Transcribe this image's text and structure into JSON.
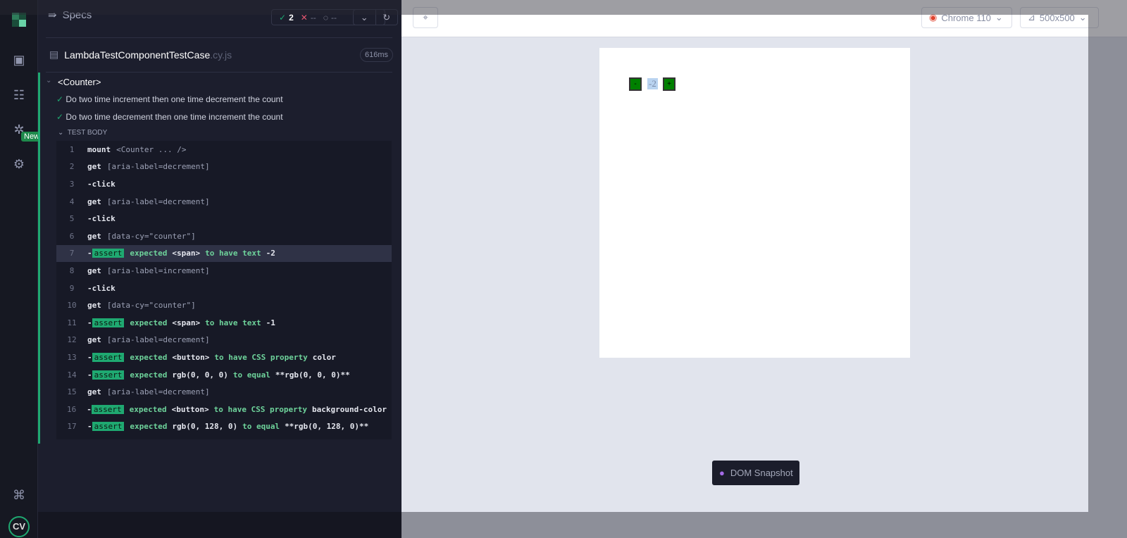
{
  "nav": {
    "new_badge": "New",
    "avatar": "CV"
  },
  "specs": {
    "title": "Specs",
    "passed": "2",
    "failed": "--",
    "pending": "--"
  },
  "file": {
    "name": "LambdaTestComponentTestCase",
    "ext": ".cy.js",
    "duration": "616ms"
  },
  "suite": {
    "name": "<Counter>",
    "tests": [
      "Do two time increment then one time decrement the count",
      "Do two time decrement then one time increment the count"
    ],
    "body_label": "TEST BODY"
  },
  "commands": [
    {
      "num": "1",
      "name": "mount",
      "sel": "<Counter ... />"
    },
    {
      "num": "2",
      "name": "get",
      "sel": "[aria-label=decrement]"
    },
    {
      "num": "3",
      "name": "-click"
    },
    {
      "num": "4",
      "name": "get",
      "sel": "[aria-label=decrement]"
    },
    {
      "num": "5",
      "name": "-click"
    },
    {
      "num": "6",
      "name": "get",
      "sel": "[data-cy=\"counter\"]"
    },
    {
      "num": "7",
      "badge": "assert",
      "parts": [
        [
          "g",
          "expected"
        ],
        [
          "w",
          "<span>"
        ],
        [
          "g",
          "to have text"
        ],
        [
          "w",
          "-2"
        ]
      ],
      "active": true
    },
    {
      "num": "8",
      "name": "get",
      "sel": "[aria-label=increment]"
    },
    {
      "num": "9",
      "name": "-click"
    },
    {
      "num": "10",
      "name": "get",
      "sel": "[data-cy=\"counter\"]"
    },
    {
      "num": "11",
      "badge": "assert",
      "parts": [
        [
          "g",
          "expected"
        ],
        [
          "w",
          "<span>"
        ],
        [
          "g",
          "to have text"
        ],
        [
          "w",
          "-1"
        ]
      ]
    },
    {
      "num": "12",
      "name": "get",
      "sel": "[aria-label=decrement]"
    },
    {
      "num": "13",
      "badge": "assert",
      "parts": [
        [
          "g",
          "expected"
        ],
        [
          "w",
          "<button>"
        ],
        [
          "g",
          "to have CSS property"
        ],
        [
          "w",
          "color"
        ]
      ]
    },
    {
      "num": "14",
      "badge": "assert",
      "parts": [
        [
          "g",
          "expected"
        ],
        [
          "w",
          "rgb(0, 0, 0)"
        ],
        [
          "g",
          "to equal"
        ],
        [
          "w",
          "**rgb(0, 0, 0)**"
        ]
      ]
    },
    {
      "num": "15",
      "name": "get",
      "sel": "[aria-label=decrement]"
    },
    {
      "num": "16",
      "badge": "assert",
      "parts": [
        [
          "g",
          "expected"
        ],
        [
          "w",
          "<button>"
        ],
        [
          "g",
          "to have CSS property"
        ],
        [
          "w",
          "background-color"
        ]
      ]
    },
    {
      "num": "17",
      "badge": "assert",
      "parts": [
        [
          "g",
          "expected"
        ],
        [
          "w",
          "rgb(0, 128, 0)"
        ],
        [
          "g",
          "to equal"
        ],
        [
          "w",
          "**rgb(0, 128, 0)**"
        ]
      ]
    }
  ],
  "browser": {
    "name": "Chrome 110",
    "viewport": "500x500"
  },
  "app": {
    "decrement": "-",
    "value": "-2",
    "increment": "+"
  },
  "snapshot": {
    "label": "DOM Snapshot"
  }
}
